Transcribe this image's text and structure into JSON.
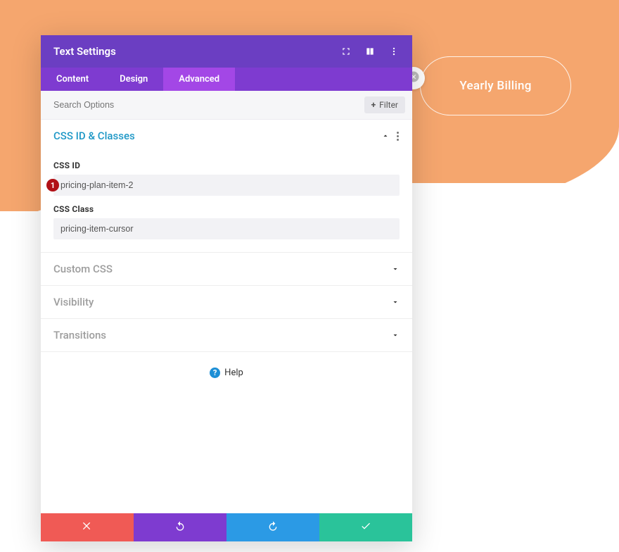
{
  "background": {
    "yearly_label": "Yearly Billing"
  },
  "modal": {
    "title": "Text Settings",
    "tabs": {
      "content": "Content",
      "design": "Design",
      "advanced": "Advanced"
    },
    "search": {
      "placeholder": "Search Options",
      "filter_label": "Filter"
    },
    "sections": {
      "css": {
        "title": "CSS ID & Classes",
        "css_id_label": "CSS ID",
        "css_id_value": "pricing-plan-item-2",
        "css_id_badge": "1",
        "css_class_label": "CSS Class",
        "css_class_value": "pricing-item-cursor"
      },
      "custom_css": {
        "title": "Custom CSS"
      },
      "visibility": {
        "title": "Visibility"
      },
      "transitions": {
        "title": "Transitions"
      }
    },
    "help_label": "Help"
  }
}
